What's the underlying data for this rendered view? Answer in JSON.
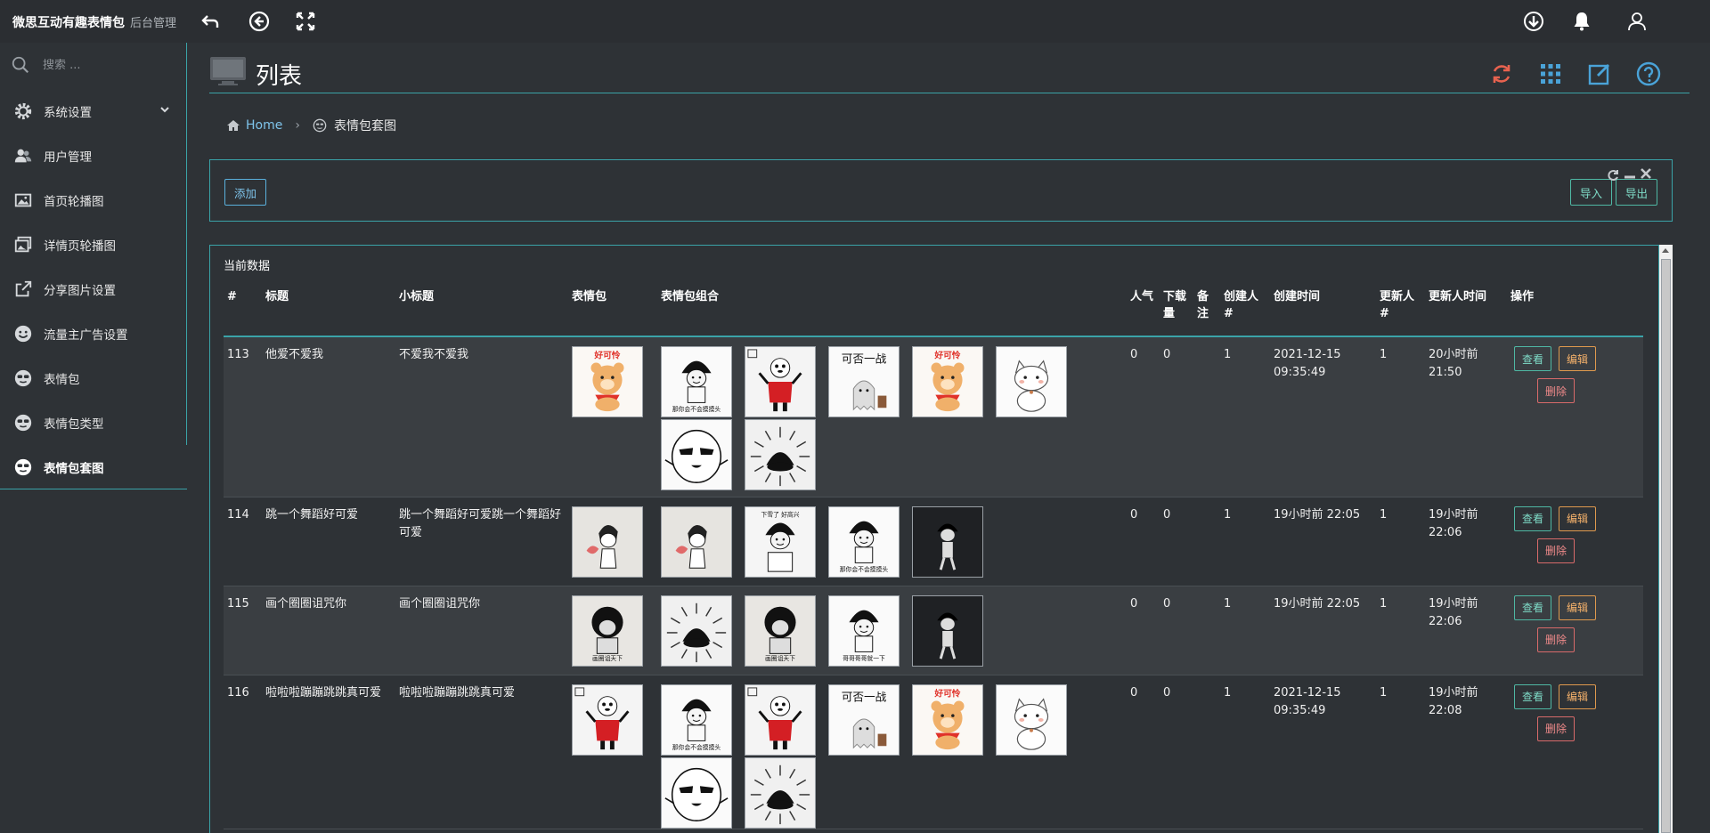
{
  "app": {
    "title": "微思互动有趣表情包",
    "subtitle": "后台管理"
  },
  "sidebar": {
    "search_placeholder": "搜索 ...",
    "items": [
      {
        "label": "系统设置",
        "icon": "gear-icon",
        "has_children": true
      },
      {
        "label": "用户管理",
        "icon": "users-icon"
      },
      {
        "label": "首页轮播图",
        "icon": "image-icon"
      },
      {
        "label": "详情页轮播图",
        "icon": "images-icon"
      },
      {
        "label": "分享图片设置",
        "icon": "share-icon"
      },
      {
        "label": "流量主广告设置",
        "icon": "smile-icon"
      },
      {
        "label": "表情包",
        "icon": "sunglasses-face-icon"
      },
      {
        "label": "表情包类型",
        "icon": "sunglasses-face-icon"
      },
      {
        "label": "表情包套图",
        "icon": "sunglasses-face-icon",
        "active": true
      }
    ]
  },
  "page": {
    "title": "列表"
  },
  "breadcrumb": {
    "home": "Home",
    "current": "表情包套图"
  },
  "toolbar": {
    "add": "添加",
    "import": "导入",
    "export": "导出"
  },
  "panel": {
    "title": "当前数据"
  },
  "table": {
    "headers": {
      "id": "#",
      "title": "标题",
      "subtitle": "小标题",
      "emoji": "表情包",
      "combo": "表情包组合",
      "popularity": "人气",
      "downloads": "下载量",
      "remark": "备注",
      "creator": "创建人#",
      "created_at": "创建时间",
      "updater": "更新人#",
      "updated_at": "更新人时间",
      "actions": "操作"
    },
    "actions": {
      "view": "查看",
      "edit": "编辑",
      "delete": "删除"
    },
    "rows": [
      {
        "id": "113",
        "title": "他爱不爱我",
        "subtitle": "不爱我不爱我",
        "emoji": "bear-haoke",
        "combo": [
          "mushroom-head-boy",
          "red-shirt-panda",
          "ghost-ke-fou-yi-zhan",
          "bear-haoke",
          "white-cat",
          "sunglasses-ghost",
          "mushroom-hair-rays"
        ],
        "combo_captions": {
          "mushroom-head-boy": "那你会不会摸摸头",
          "ghost-ke-fou-yi-zhan": "可否一战",
          "bear-haoke": "好可怜"
        },
        "popularity": "0",
        "downloads": "0",
        "remark": "",
        "creator": "1",
        "created_at": "2021-12-15 09:35:49",
        "updater": "1",
        "updated_at": "20小时前 21:50"
      },
      {
        "id": "114",
        "title": "跳一个舞蹈好可爱",
        "subtitle": "跳一个舞蹈好可爱跳一个舞蹈好可爱",
        "emoji": "dancing-girl",
        "combo": [
          "dancing-girl",
          "crying-boy",
          "mushroom-head-boy",
          "walking-boy"
        ],
        "combo_captions": {
          "crying-boy": "下雪了 好高兴",
          "mushroom-head-boy": "那你会不会摸摸头"
        },
        "popularity": "0",
        "downloads": "0",
        "remark": "",
        "creator": "1",
        "created_at": "19小时前 22:05",
        "updater": "1",
        "updated_at": "19小时前 22:06"
      },
      {
        "id": "115",
        "title": "画个圈圈诅咒你",
        "subtitle": "画个圈圈诅咒你",
        "emoji": "curse-boy",
        "combo": [
          "mushroom-hair-rays",
          "curse-boy",
          "mushroom-head-boy-2",
          "walking-boy"
        ],
        "combo_captions": {
          "curse-boy": "画圈诅天下",
          "mushroom-head-boy-2": "哥哥哥哥就一下"
        },
        "popularity": "0",
        "downloads": "0",
        "remark": "",
        "creator": "1",
        "created_at": "19小时前 22:05",
        "updater": "1",
        "updated_at": "19小时前 22:06"
      },
      {
        "id": "116",
        "title": "啦啦啦蹦蹦跳跳真可爱",
        "subtitle": "啦啦啦蹦蹦跳跳真可爱",
        "emoji": "red-shirt-panda",
        "combo": [
          "mushroom-head-boy",
          "red-shirt-panda",
          "ghost-ke-fou-yi-zhan",
          "bear-haoke",
          "white-cat",
          "sunglasses-ghost",
          "mushroom-hair-rays"
        ],
        "combo_captions": {
          "mushroom-head-boy": "那你会不会摸摸头",
          "ghost-ke-fou-yi-zhan": "可否一战",
          "bear-haoke": "好可怜"
        },
        "popularity": "0",
        "downloads": "0",
        "remark": "",
        "creator": "1",
        "created_at": "2021-12-15 09:35:49",
        "updater": "1",
        "updated_at": "19小时前 22:08"
      }
    ]
  }
}
